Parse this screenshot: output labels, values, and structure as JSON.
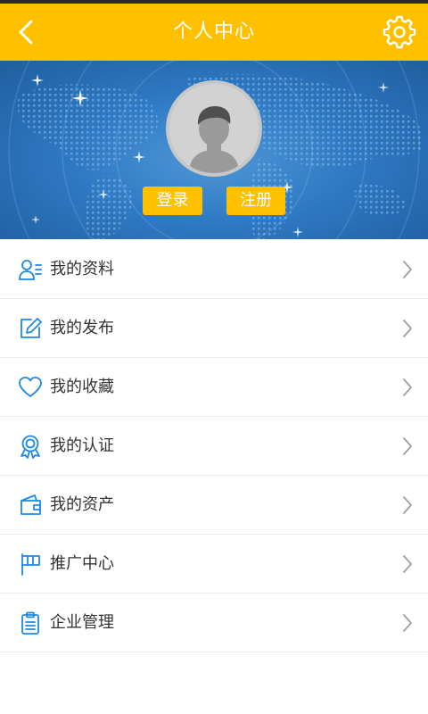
{
  "header": {
    "title": "个人中心",
    "back_icon": "chevron-left-icon",
    "settings_icon": "gear-icon"
  },
  "profile": {
    "avatar_icon": "default-avatar-icon",
    "login_label": "登录",
    "register_label": "注册"
  },
  "menu": {
    "items": [
      {
        "label": "我的资料",
        "icon": "profile-card-icon"
      },
      {
        "label": "我的发布",
        "icon": "edit-icon"
      },
      {
        "label": "我的收藏",
        "icon": "heart-icon"
      },
      {
        "label": "我的认证",
        "icon": "award-badge-icon"
      },
      {
        "label": "我的资产",
        "icon": "wallet-icon"
      },
      {
        "label": "推广中心",
        "icon": "flag-icon"
      },
      {
        "label": "企业管理",
        "icon": "clipboard-icon"
      }
    ]
  },
  "colors": {
    "accent": "#ffc000",
    "banner_blue": "#2f7ac4",
    "icon_blue": "#1e88e5",
    "text": "#333333"
  }
}
